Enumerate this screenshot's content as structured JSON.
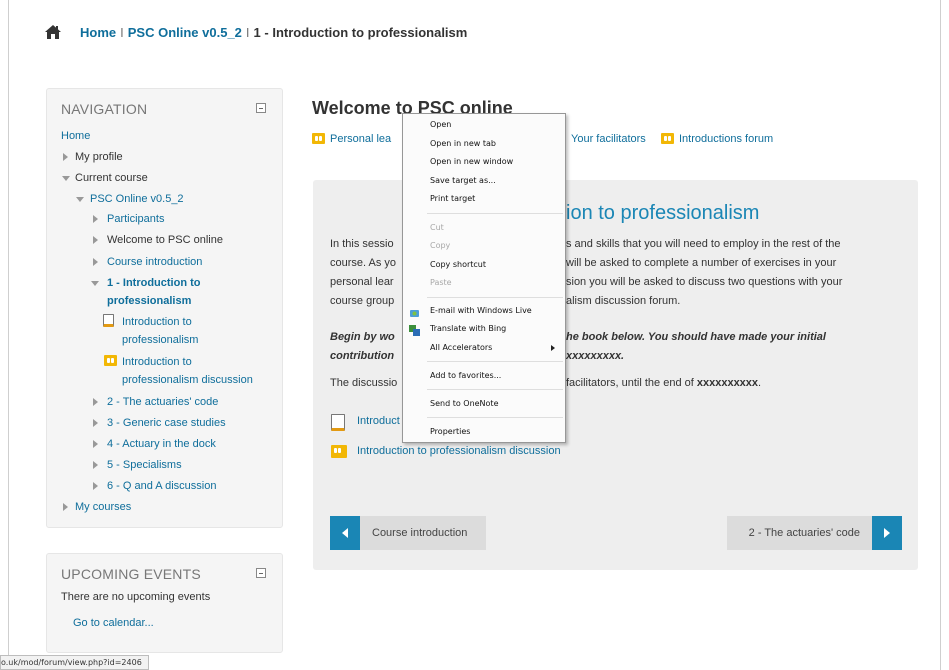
{
  "breadcrumb": {
    "home": "Home",
    "sep1": "I",
    "course": "PSC Online v0.5_2",
    "sep2": "I",
    "current": "1 - Introduction to professionalism"
  },
  "navigation": {
    "title": "NAVIGATION",
    "home": "Home",
    "my_profile": "My profile",
    "current_course": "Current course",
    "course": "PSC Online v0.5_2",
    "participants": "Participants",
    "welcome": "Welcome to PSC online",
    "course_intro": "Course introduction",
    "topic1_line1": "1 - Introduction to",
    "topic1_line2": "professionalism",
    "book_line1": "Introduction to",
    "book_line2": "professionalism",
    "forum_line1": "Introduction to",
    "forum_line2": "professionalism discussion",
    "topic2": "2 - The actuaries' code",
    "topic3": "3 - Generic case studies",
    "topic4": "4 - Actuary in the dock",
    "topic5": "5 - Specialisms",
    "topic6": "6 - Q and A discussion",
    "my_courses": "My courses"
  },
  "events": {
    "title": "UPCOMING EVENTS",
    "none": "There are no upcoming events",
    "calendar": "Go to calendar..."
  },
  "main": {
    "title": "Welcome to PSC online",
    "link_personal": "Personal lea",
    "link_facilitators": "Your facilitators",
    "link_introductions": "Introductions forum",
    "section_title": "ion to professionalism",
    "p1_a1": "In this sessio",
    "p1_b1": "s and skills that you will need to employ in the rest of the",
    "p1_a2": "course. As yo",
    "p1_b2": "will be asked to complete a number of exercises in your",
    "p1_a3": "personal lear",
    "p1_b3": "sion you will be asked to discuss two questions with your",
    "p1_a4": "course group",
    "p1_b4": "alism discussion forum.",
    "p2_a1": "Begin by wo",
    "p2_b1": "he book below. You should have made your initial",
    "p2_a2": "contribution",
    "p2_b2": "xxxxxxxxx.",
    "p3_a": "The discussio",
    "p3_b": "facilitators, until the end of",
    "p3_bold": "xxxxxxxxxx",
    "p3_end": ".",
    "res_book": "Introduct",
    "res_forum": "Introduction to professionalism discussion",
    "prev_btn": "Course introduction",
    "next_btn": "2 - The actuaries' code"
  },
  "context_menu": {
    "open": "Open",
    "open_tab": "Open in new tab",
    "open_window": "Open in new window",
    "save_target": "Save target as...",
    "print_target": "Print target",
    "cut": "Cut",
    "copy": "Copy",
    "copy_shortcut": "Copy shortcut",
    "paste": "Paste",
    "email": "E-mail with Windows Live",
    "translate": "Translate with Bing",
    "accelerators": "All Accelerators",
    "favorites": "Add to favorites...",
    "onenote": "Send to OneNote",
    "properties": "Properties"
  },
  "status_bar": {
    "url": "o.uk/mod/forum/view.php?id=2406"
  },
  "colors": {
    "link": "#0f6e9b",
    "accent": "#1a86b5",
    "forum_icon": "#f2b705"
  }
}
